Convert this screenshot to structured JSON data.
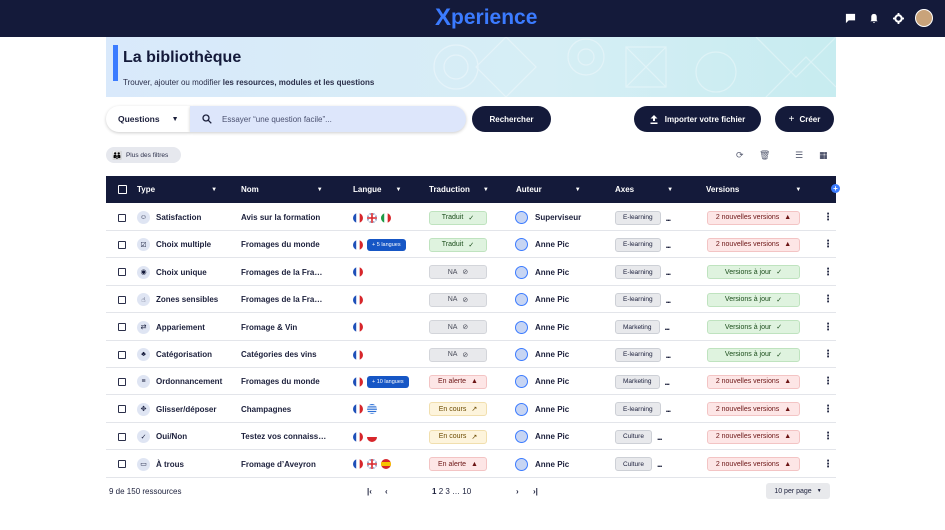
{
  "app": {
    "logo_mark": "X",
    "logo_text": "perience"
  },
  "topbar": {
    "icons": [
      "chat-icon",
      "bell-icon",
      "gear-icon",
      "user-avatar"
    ]
  },
  "banner": {
    "title": "La bibliothèque",
    "subtitle_prefix": "Trouver, ajouter ou modifier ",
    "subtitle_bold": "les resources, modules et les questions"
  },
  "search": {
    "select_value": "Questions",
    "placeholder": "Essayer “une question facile”...",
    "search_button": "Rechercher",
    "import_button": "Importer votre fichier",
    "create_button": "Créer"
  },
  "filters": {
    "label": "Plus des filtres"
  },
  "table": {
    "headers": [
      "Type",
      "Nom",
      "Langue",
      "Traduction",
      "Auteur",
      "Axes",
      "Versions"
    ],
    "rows": [
      {
        "type": "Satisfaction",
        "type_icon": "smiley-icon",
        "nom": "Avis sur la formation",
        "flags": [
          "fr",
          "gb",
          "it"
        ],
        "more_lang": "",
        "trad": "Traduit",
        "trad_state": "green",
        "auteur": "Superviseur",
        "axe": "E-learning",
        "version": "2 nouvelles versions",
        "version_state": "red"
      },
      {
        "type": "Choix multiple",
        "type_icon": "checkbox-icon",
        "nom": "Fromages du monde",
        "flags": [
          "fr"
        ],
        "more_lang": "+ 5 langues",
        "trad": "Traduit",
        "trad_state": "green",
        "auteur": "Anne Pic",
        "axe": "E-learning",
        "version": "2 nouvelles versions",
        "version_state": "red"
      },
      {
        "type": "Choix unique",
        "type_icon": "radio-icon",
        "nom": "Fromages de la Fra…",
        "flags": [
          "fr"
        ],
        "more_lang": "",
        "trad": "NA",
        "trad_state": "grey",
        "auteur": "Anne Pic",
        "axe": "E-learning",
        "version": "Versions à jour",
        "version_state": "green"
      },
      {
        "type": "Zones sensibles",
        "type_icon": "hand-pointer-icon",
        "nom": "Fromages de la Fra…",
        "flags": [
          "fr"
        ],
        "more_lang": "",
        "trad": "NA",
        "trad_state": "grey",
        "auteur": "Anne Pic",
        "axe": "E-learning",
        "version": "Versions à jour",
        "version_state": "green"
      },
      {
        "type": "Appariement",
        "type_icon": "match-icon",
        "nom": "Fromage & Vin",
        "flags": [
          "fr"
        ],
        "more_lang": "",
        "trad": "NA",
        "trad_state": "grey",
        "auteur": "Anne Pic",
        "axe": "Marketing",
        "version": "Versions à jour",
        "version_state": "green"
      },
      {
        "type": "Catégorisation",
        "type_icon": "shapes-icon",
        "nom": "Catégories des vins",
        "flags": [
          "fr"
        ],
        "more_lang": "",
        "trad": "NA",
        "trad_state": "grey",
        "auteur": "Anne Pic",
        "axe": "E-learning",
        "version": "Versions à jour",
        "version_state": "green"
      },
      {
        "type": "Ordonnancement",
        "type_icon": "list-icon",
        "nom": "Fromages du monde",
        "flags": [
          "fr"
        ],
        "more_lang": "+ 10 langues",
        "trad": "En alerte",
        "trad_state": "red",
        "auteur": "Anne Pic",
        "axe": "Marketing",
        "version": "2 nouvelles versions",
        "version_state": "red"
      },
      {
        "type": "Glisser/déposer",
        "type_icon": "move-icon",
        "nom": "Champagnes",
        "flags": [
          "fr",
          "gr"
        ],
        "more_lang": "",
        "trad": "En cours",
        "trad_state": "yellow",
        "auteur": "Anne Pic",
        "axe": "E-learning",
        "version": "2 nouvelles versions",
        "version_state": "red"
      },
      {
        "type": "Oui/Non",
        "type_icon": "check-cross-icon",
        "nom": "Testez vos connaiss…",
        "flags": [
          "fr",
          "pl"
        ],
        "more_lang": "",
        "trad": "En cours",
        "trad_state": "yellow",
        "auteur": "Anne Pic",
        "axe": "Culture",
        "version": "2 nouvelles versions",
        "version_state": "red"
      },
      {
        "type": "À trous",
        "type_icon": "blank-icon",
        "nom": "Fromage d’Aveyron",
        "flags": [
          "fr",
          "gb",
          "es"
        ],
        "more_lang": "",
        "trad": "En alerte",
        "trad_state": "red",
        "auteur": "Anne Pic",
        "axe": "Culture",
        "version": "2 nouvelles versions",
        "version_state": "red"
      }
    ]
  },
  "footer": {
    "count": "9 de 150 ressources",
    "pages_current": "1",
    "pages_rest": "2 3 … 10",
    "per_page": "10 per page"
  },
  "colors": {
    "navy": "#141a3a",
    "accent": "#3b7bff"
  }
}
